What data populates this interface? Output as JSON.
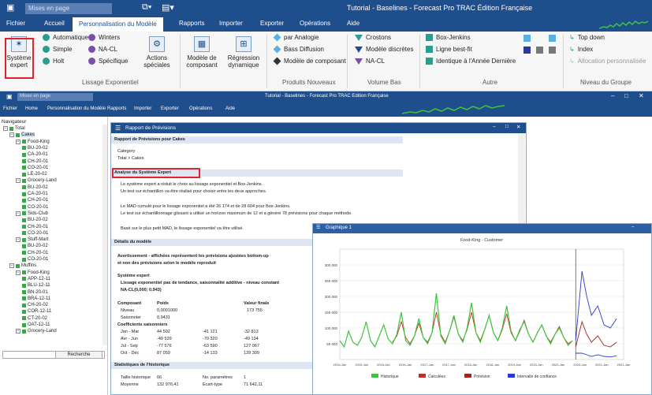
{
  "window_title": "Tutorial - Baselines - Forecast Pro TRAC Édition Française",
  "quick_access": "Mises en page",
  "ribbon_tabs": [
    "Fichier",
    "Accueil",
    "Personnalisation du Modèle",
    "Rapports",
    "Importer",
    "Exporter",
    "Opérations",
    "Aide"
  ],
  "ribbon": {
    "expert_label": "Système expert",
    "exp_items": [
      "Automatique",
      "Simple",
      "Holt"
    ],
    "exp_items2": [
      "Winters",
      "NA-CL",
      "Spécifique"
    ],
    "actions": "Actions spéciales",
    "group_exp": "Lissage Exponentiel",
    "modele": "Modèle de composant",
    "regression": "Régression dynamique",
    "new_items": [
      "par Analogie",
      "Bass Diffusion",
      "Modèle de composant"
    ],
    "group_new": "Produits Nouveaux",
    "low_items": [
      "Crostons",
      "Modèle discrètes",
      "NA-CL"
    ],
    "group_low": "Volume Bas",
    "other_items": [
      "Box-Jenkins",
      "Ligne best-fit",
      "Identique à l'Année Dernière"
    ],
    "group_other": "Autre",
    "group_items": [
      "Top down",
      "Index",
      "Allocation personnalisée"
    ],
    "group_group": "Niveau du Groupe",
    "colors": {
      "blue": "#1f4e8c",
      "green": "#3ea34a",
      "red": "#e0232e"
    }
  },
  "inner": {
    "title": "Tutorial - Baselines - Forecast Pro TRAC Edition Française",
    "quick": "Mises en page",
    "tabs": [
      "Fichier",
      "Home",
      "Personnalisation du Modèle",
      "Rapports",
      "Importer",
      "Exporter",
      "Opérations",
      "Aide"
    ]
  },
  "navigator": {
    "title": "Navigateur",
    "search_button": "Recherche",
    "items": [
      {
        "t": "Total",
        "l": 0
      },
      {
        "t": "Cakes",
        "l": 1
      },
      {
        "t": "Food-King",
        "l": 2
      },
      {
        "t": "BU-20-02",
        "l": 3
      },
      {
        "t": "CA-20-01",
        "l": 3
      },
      {
        "t": "CH-20-01",
        "l": 3
      },
      {
        "t": "CO-20-01",
        "l": 3
      },
      {
        "t": "LE-20-02",
        "l": 3
      },
      {
        "t": "Grocery-Land",
        "l": 2
      },
      {
        "t": "BU-20-02",
        "l": 3
      },
      {
        "t": "CA-20-01",
        "l": 3
      },
      {
        "t": "CH-20-01",
        "l": 3
      },
      {
        "t": "CO-20-01",
        "l": 3
      },
      {
        "t": "Sids-Club",
        "l": 2
      },
      {
        "t": "BU-20-02",
        "l": 3
      },
      {
        "t": "CH-20-01",
        "l": 3
      },
      {
        "t": "CO-20-01",
        "l": 3
      },
      {
        "t": "Stuff-Mart",
        "l": 2
      },
      {
        "t": "BU-20-02",
        "l": 3
      },
      {
        "t": "CH-20-01",
        "l": 3
      },
      {
        "t": "CO-20-01",
        "l": 3
      },
      {
        "t": "Muffins",
        "l": 1
      },
      {
        "t": "Food-King",
        "l": 2
      },
      {
        "t": "APP-12-11",
        "l": 3
      },
      {
        "t": "BLU-12-11",
        "l": 3
      },
      {
        "t": "BN-20-01",
        "l": 3
      },
      {
        "t": "BRA-12-11",
        "l": 3
      },
      {
        "t": "CH-20-02",
        "l": 3
      },
      {
        "t": "COR-12-11",
        "l": 3
      },
      {
        "t": "CT-20-02",
        "l": 3
      },
      {
        "t": "OAT-12-11",
        "l": 3
      },
      {
        "t": "Grocery-Land",
        "l": 2
      }
    ]
  },
  "report": {
    "title": "Rapport de Prévisions",
    "header": "Rapport de Prévisions pour Cakes",
    "category_label": "Category",
    "category_value": "Total > Cakes",
    "section_expert": "Analyse du Système Expert",
    "lines": [
      "Le système expert a réduit le choix au lissage exponentiel et Box-Jenkins.",
      "Un test sur échantillon va être réalisé pour choisir entre les deux approches.",
      "Le MAD cumulé pour le lissage exponentiel a été 26 174 et de 28 604 pour Box-Jenkins.",
      "Le test sur échantillonnage glissant a utilisé un horizon maximum de 12 et a généré 78 prévisions pour chaque méthode.",
      "Basé sur le plus petit MAD, le lissage exponentiel va être utilisé."
    ],
    "section_details": "Détails du modèle",
    "warning1": "Avertissement - affichées représentent les prévisions ajustées bottom-up",
    "warning2": "et non des prévisions selon le modèle reproduit",
    "expert_label": "Système expert",
    "model_desc": "Lissage exponentiel pas de tendance, saisonnalité additive - niveau constant",
    "model_code": "NA-CL(0,000; 0,943)",
    "comp_headers": [
      "Composant",
      "Poids",
      "Valeur finale"
    ],
    "comp_rows": [
      [
        "Niveau",
        "0,0001000",
        "173 755"
      ],
      [
        "Saisonnier",
        "0,9431",
        ""
      ]
    ],
    "coef_title": "Coefficients saisonniers",
    "coef_rows": [
      [
        "Jan - Mar",
        "44 502",
        "-41 121",
        "-32 813"
      ],
      [
        "Avr - Jun",
        "-49 539",
        "-70 320",
        "-49 134"
      ],
      [
        "Jul - Sep",
        "-77 576",
        "-63 590",
        "127 067"
      ],
      [
        "Oct - Déc",
        "87 059",
        "-14 133",
        "139 309"
      ]
    ],
    "stats_title": "Statistiques de l'historique",
    "stats_rows": [
      [
        "Taille historique",
        "66",
        "No. paramètres",
        "1"
      ],
      [
        "Moyenne",
        "132 976,41",
        "Ecart-type",
        "71 642,11"
      ]
    ]
  },
  "chart_window": {
    "title": "Graphique 1"
  },
  "chart_data": {
    "type": "line",
    "title": "Food-King - Customer",
    "ylim": [
      0,
      350000
    ],
    "yticks": [
      "300 000",
      "250 000",
      "200 000",
      "150 000",
      "100 000",
      "50 000"
    ],
    "xticks": [
      "2015-Jan",
      "2015-Jan",
      "2016-Jan",
      "2016-Jan",
      "2017-Jan",
      "2017-Jan",
      "2018-Jan",
      "2018-Jan",
      "2019-Jan",
      "2019-Jan",
      "2020-Jan",
      "2020-Jan",
      "2021-Jan",
      "2021-Jan"
    ],
    "legend_placement": "bottom",
    "series": [
      {
        "name": "Historique",
        "color": "#3ec43e",
        "values": [
          60000,
          40000,
          90000,
          55000,
          45000,
          70000,
          120000,
          60000,
          40000,
          75000,
          110000,
          65000,
          50000,
          80000,
          150000,
          60000,
          45000,
          75000,
          130000,
          70000,
          50000,
          85000,
          210000,
          75000,
          50000,
          90000,
          140000,
          80000,
          55000,
          100000,
          180000,
          85000,
          55000,
          95000,
          140000,
          85000,
          60000,
          100000,
          170000,
          90000,
          60000,
          95000,
          120000,
          80000,
          55000,
          85000,
          110000,
          75000,
          50000,
          80000,
          100000,
          70000,
          45000,
          60000
        ]
      },
      {
        "name": "Calculées",
        "color": "#c0302a",
        "values": [
          null,
          null,
          null,
          null,
          null,
          null,
          null,
          null,
          null,
          null,
          null,
          null,
          55000,
          75000,
          120000,
          70000,
          50000,
          75000,
          115000,
          70000,
          55000,
          85000,
          150000,
          80000,
          55000,
          90000,
          135000,
          80000,
          60000,
          95000,
          150000,
          85000,
          60000,
          95000,
          140000,
          85000,
          60000,
          95000,
          145000,
          85000,
          60000,
          90000,
          125000,
          80000,
          55000,
          85000,
          110000,
          75000,
          55000,
          80000,
          105000,
          70000,
          50000,
          60000
        ]
      },
      {
        "name": "Prévision",
        "color": "#a82220",
        "values": []
      },
      {
        "name": "Intervalle de confiance",
        "color": "#2a3ad0",
        "values": []
      }
    ]
  }
}
